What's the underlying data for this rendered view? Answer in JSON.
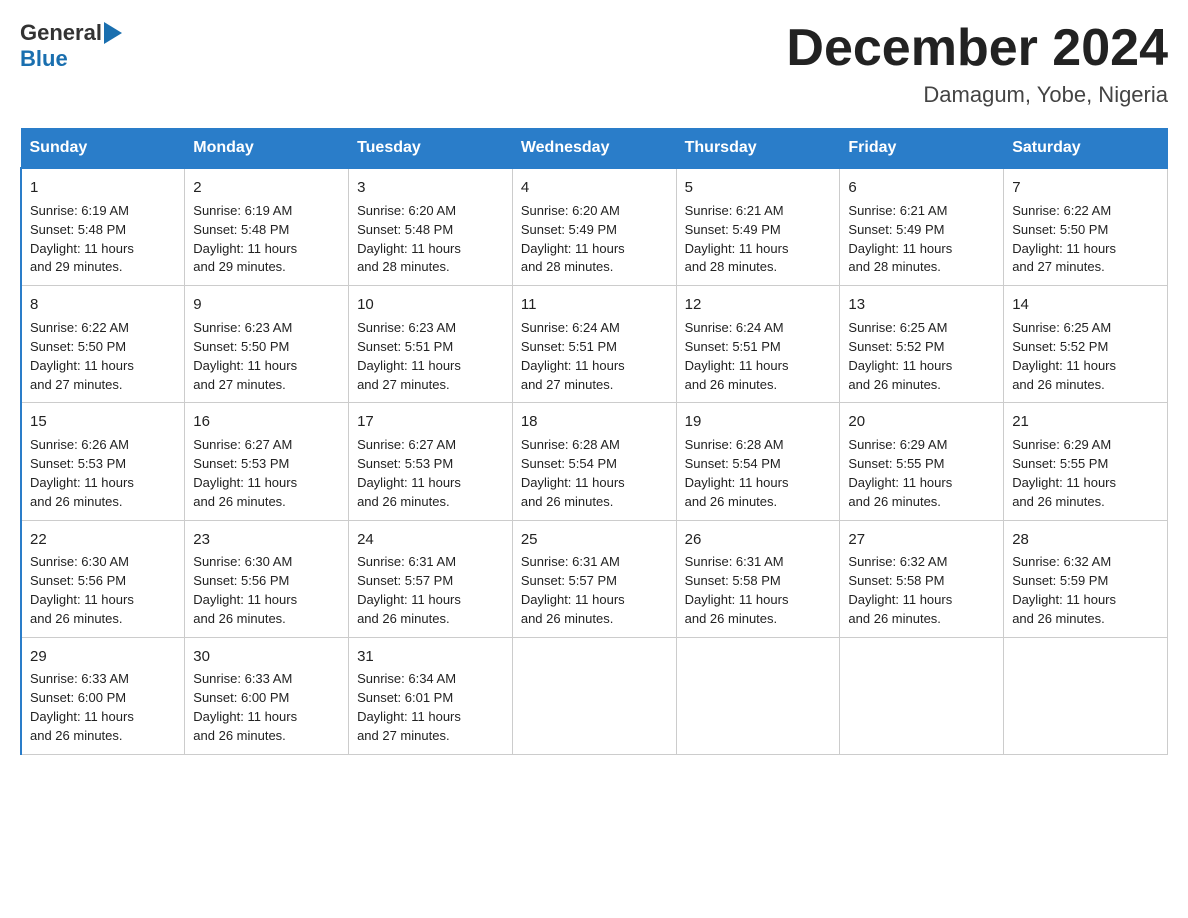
{
  "logo": {
    "general": "General",
    "blue": "Blue"
  },
  "title": "December 2024",
  "subtitle": "Damagum, Yobe, Nigeria",
  "weekdays": [
    "Sunday",
    "Monday",
    "Tuesday",
    "Wednesday",
    "Thursday",
    "Friday",
    "Saturday"
  ],
  "weeks": [
    [
      {
        "day": "1",
        "sunrise": "6:19 AM",
        "sunset": "5:48 PM",
        "daylight": "11 hours and 29 minutes."
      },
      {
        "day": "2",
        "sunrise": "6:19 AM",
        "sunset": "5:48 PM",
        "daylight": "11 hours and 29 minutes."
      },
      {
        "day": "3",
        "sunrise": "6:20 AM",
        "sunset": "5:48 PM",
        "daylight": "11 hours and 28 minutes."
      },
      {
        "day": "4",
        "sunrise": "6:20 AM",
        "sunset": "5:49 PM",
        "daylight": "11 hours and 28 minutes."
      },
      {
        "day": "5",
        "sunrise": "6:21 AM",
        "sunset": "5:49 PM",
        "daylight": "11 hours and 28 minutes."
      },
      {
        "day": "6",
        "sunrise": "6:21 AM",
        "sunset": "5:49 PM",
        "daylight": "11 hours and 28 minutes."
      },
      {
        "day": "7",
        "sunrise": "6:22 AM",
        "sunset": "5:50 PM",
        "daylight": "11 hours and 27 minutes."
      }
    ],
    [
      {
        "day": "8",
        "sunrise": "6:22 AM",
        "sunset": "5:50 PM",
        "daylight": "11 hours and 27 minutes."
      },
      {
        "day": "9",
        "sunrise": "6:23 AM",
        "sunset": "5:50 PM",
        "daylight": "11 hours and 27 minutes."
      },
      {
        "day": "10",
        "sunrise": "6:23 AM",
        "sunset": "5:51 PM",
        "daylight": "11 hours and 27 minutes."
      },
      {
        "day": "11",
        "sunrise": "6:24 AM",
        "sunset": "5:51 PM",
        "daylight": "11 hours and 27 minutes."
      },
      {
        "day": "12",
        "sunrise": "6:24 AM",
        "sunset": "5:51 PM",
        "daylight": "11 hours and 26 minutes."
      },
      {
        "day": "13",
        "sunrise": "6:25 AM",
        "sunset": "5:52 PM",
        "daylight": "11 hours and 26 minutes."
      },
      {
        "day": "14",
        "sunrise": "6:25 AM",
        "sunset": "5:52 PM",
        "daylight": "11 hours and 26 minutes."
      }
    ],
    [
      {
        "day": "15",
        "sunrise": "6:26 AM",
        "sunset": "5:53 PM",
        "daylight": "11 hours and 26 minutes."
      },
      {
        "day": "16",
        "sunrise": "6:27 AM",
        "sunset": "5:53 PM",
        "daylight": "11 hours and 26 minutes."
      },
      {
        "day": "17",
        "sunrise": "6:27 AM",
        "sunset": "5:53 PM",
        "daylight": "11 hours and 26 minutes."
      },
      {
        "day": "18",
        "sunrise": "6:28 AM",
        "sunset": "5:54 PM",
        "daylight": "11 hours and 26 minutes."
      },
      {
        "day": "19",
        "sunrise": "6:28 AM",
        "sunset": "5:54 PM",
        "daylight": "11 hours and 26 minutes."
      },
      {
        "day": "20",
        "sunrise": "6:29 AM",
        "sunset": "5:55 PM",
        "daylight": "11 hours and 26 minutes."
      },
      {
        "day": "21",
        "sunrise": "6:29 AM",
        "sunset": "5:55 PM",
        "daylight": "11 hours and 26 minutes."
      }
    ],
    [
      {
        "day": "22",
        "sunrise": "6:30 AM",
        "sunset": "5:56 PM",
        "daylight": "11 hours and 26 minutes."
      },
      {
        "day": "23",
        "sunrise": "6:30 AM",
        "sunset": "5:56 PM",
        "daylight": "11 hours and 26 minutes."
      },
      {
        "day": "24",
        "sunrise": "6:31 AM",
        "sunset": "5:57 PM",
        "daylight": "11 hours and 26 minutes."
      },
      {
        "day": "25",
        "sunrise": "6:31 AM",
        "sunset": "5:57 PM",
        "daylight": "11 hours and 26 minutes."
      },
      {
        "day": "26",
        "sunrise": "6:31 AM",
        "sunset": "5:58 PM",
        "daylight": "11 hours and 26 minutes."
      },
      {
        "day": "27",
        "sunrise": "6:32 AM",
        "sunset": "5:58 PM",
        "daylight": "11 hours and 26 minutes."
      },
      {
        "day": "28",
        "sunrise": "6:32 AM",
        "sunset": "5:59 PM",
        "daylight": "11 hours and 26 minutes."
      }
    ],
    [
      {
        "day": "29",
        "sunrise": "6:33 AM",
        "sunset": "6:00 PM",
        "daylight": "11 hours and 26 minutes."
      },
      {
        "day": "30",
        "sunrise": "6:33 AM",
        "sunset": "6:00 PM",
        "daylight": "11 hours and 26 minutes."
      },
      {
        "day": "31",
        "sunrise": "6:34 AM",
        "sunset": "6:01 PM",
        "daylight": "11 hours and 27 minutes."
      },
      null,
      null,
      null,
      null
    ]
  ],
  "labels": {
    "sunrise": "Sunrise:",
    "sunset": "Sunset:",
    "daylight": "Daylight:"
  }
}
